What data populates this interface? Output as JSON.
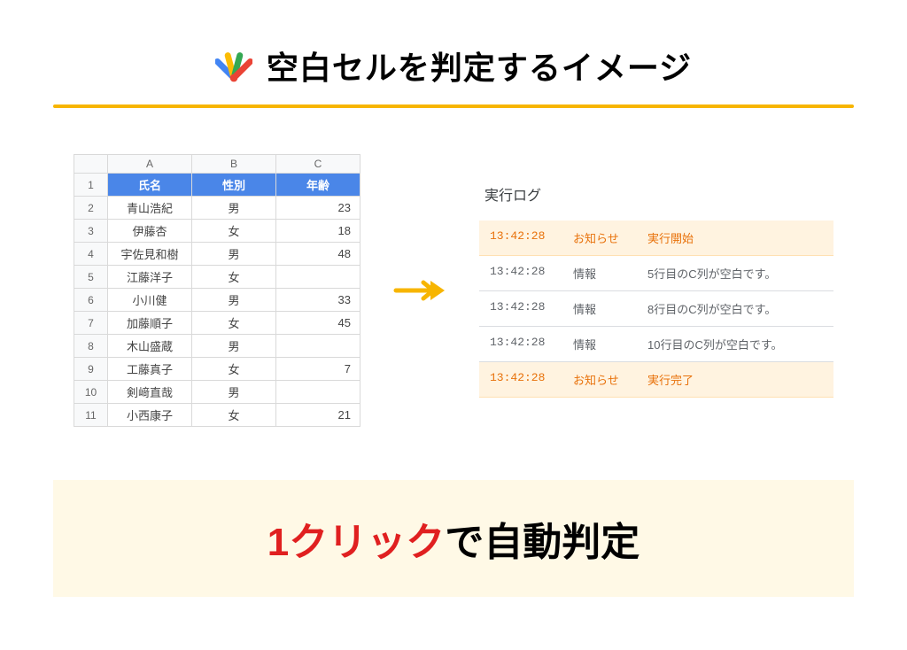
{
  "title": "空白セルを判定するイメージ",
  "spreadsheet": {
    "columns": [
      "A",
      "B",
      "C"
    ],
    "headers": [
      "氏名",
      "性別",
      "年齢"
    ],
    "rows": [
      {
        "num": "1"
      },
      {
        "num": "2",
        "a": "青山浩紀",
        "b": "男",
        "c": "23"
      },
      {
        "num": "3",
        "a": "伊藤杏",
        "b": "女",
        "c": "18"
      },
      {
        "num": "4",
        "a": "宇佐見和樹",
        "b": "男",
        "c": "48"
      },
      {
        "num": "5",
        "a": "江藤洋子",
        "b": "女",
        "c": ""
      },
      {
        "num": "6",
        "a": "小川健",
        "b": "男",
        "c": "33"
      },
      {
        "num": "7",
        "a": "加藤順子",
        "b": "女",
        "c": "45"
      },
      {
        "num": "8",
        "a": "木山盛蔵",
        "b": "男",
        "c": ""
      },
      {
        "num": "9",
        "a": "工藤真子",
        "b": "女",
        "c": "7"
      },
      {
        "num": "10",
        "a": "剣﨑直哉",
        "b": "男",
        "c": ""
      },
      {
        "num": "11",
        "a": "小西康子",
        "b": "女",
        "c": "21"
      }
    ]
  },
  "log": {
    "title": "実行ログ",
    "entries": [
      {
        "time": "13:42:28",
        "tag": "お知らせ",
        "msg": "実行開始",
        "notice": true
      },
      {
        "time": "13:42:28",
        "tag": "情報",
        "msg": "5行目のC列が空白です。",
        "notice": false
      },
      {
        "time": "13:42:28",
        "tag": "情報",
        "msg": "8行目のC列が空白です。",
        "notice": false
      },
      {
        "time": "13:42:28",
        "tag": "情報",
        "msg": "10行目のC列が空白です。",
        "notice": false
      },
      {
        "time": "13:42:28",
        "tag": "お知らせ",
        "msg": "実行完了",
        "notice": true
      }
    ]
  },
  "banner": {
    "highlight": "1クリック",
    "rest": "で自動判定"
  }
}
